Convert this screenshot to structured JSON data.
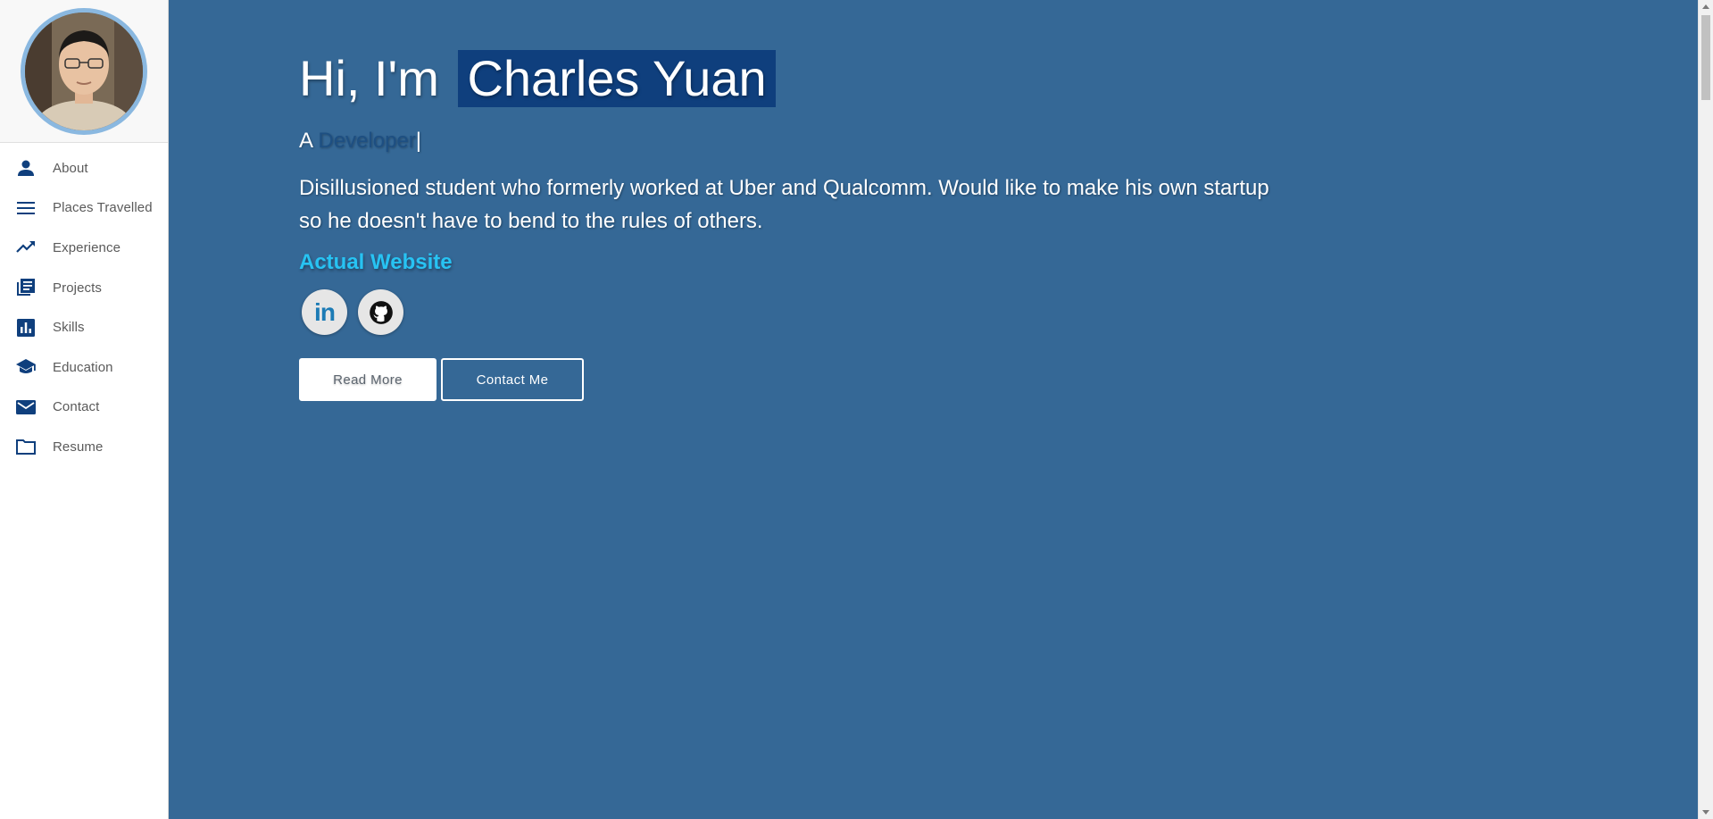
{
  "sidebar": {
    "avatar_alt": "profile-photo",
    "items": [
      {
        "label": "About",
        "icon": "person-icon"
      },
      {
        "label": "Places Travelled",
        "icon": "menu-lines-icon"
      },
      {
        "label": "Experience",
        "icon": "trending-up-icon"
      },
      {
        "label": "Projects",
        "icon": "library-books-icon"
      },
      {
        "label": "Skills",
        "icon": "bar-chart-icon"
      },
      {
        "label": "Education",
        "icon": "school-icon"
      },
      {
        "label": "Contact",
        "icon": "mail-icon"
      },
      {
        "label": "Resume",
        "icon": "folder-icon"
      }
    ]
  },
  "hero": {
    "greeting_prefix": "Hi, I'm",
    "name": "Charles Yuan",
    "typed_prefix": "A",
    "typed_role": "Developer",
    "typed_cursor": "|",
    "bio": "Disillusioned student who formerly worked at Uber and Qualcomm. Would like to make his own startup so he doesn't have to bend to the rules of others.",
    "website_link": "Actual Website",
    "socials": [
      {
        "icon": "linkedin-icon",
        "glyph": "in"
      },
      {
        "icon": "github-icon"
      }
    ],
    "read_more_label": "Read More",
    "contact_label": "Contact Me"
  },
  "colors": {
    "main_bg": "#356896",
    "name_highlight": "#0f3f7d",
    "link": "#27c3f3",
    "icon": "#0f3f7d",
    "avatar_border": "#8ab8e0"
  }
}
